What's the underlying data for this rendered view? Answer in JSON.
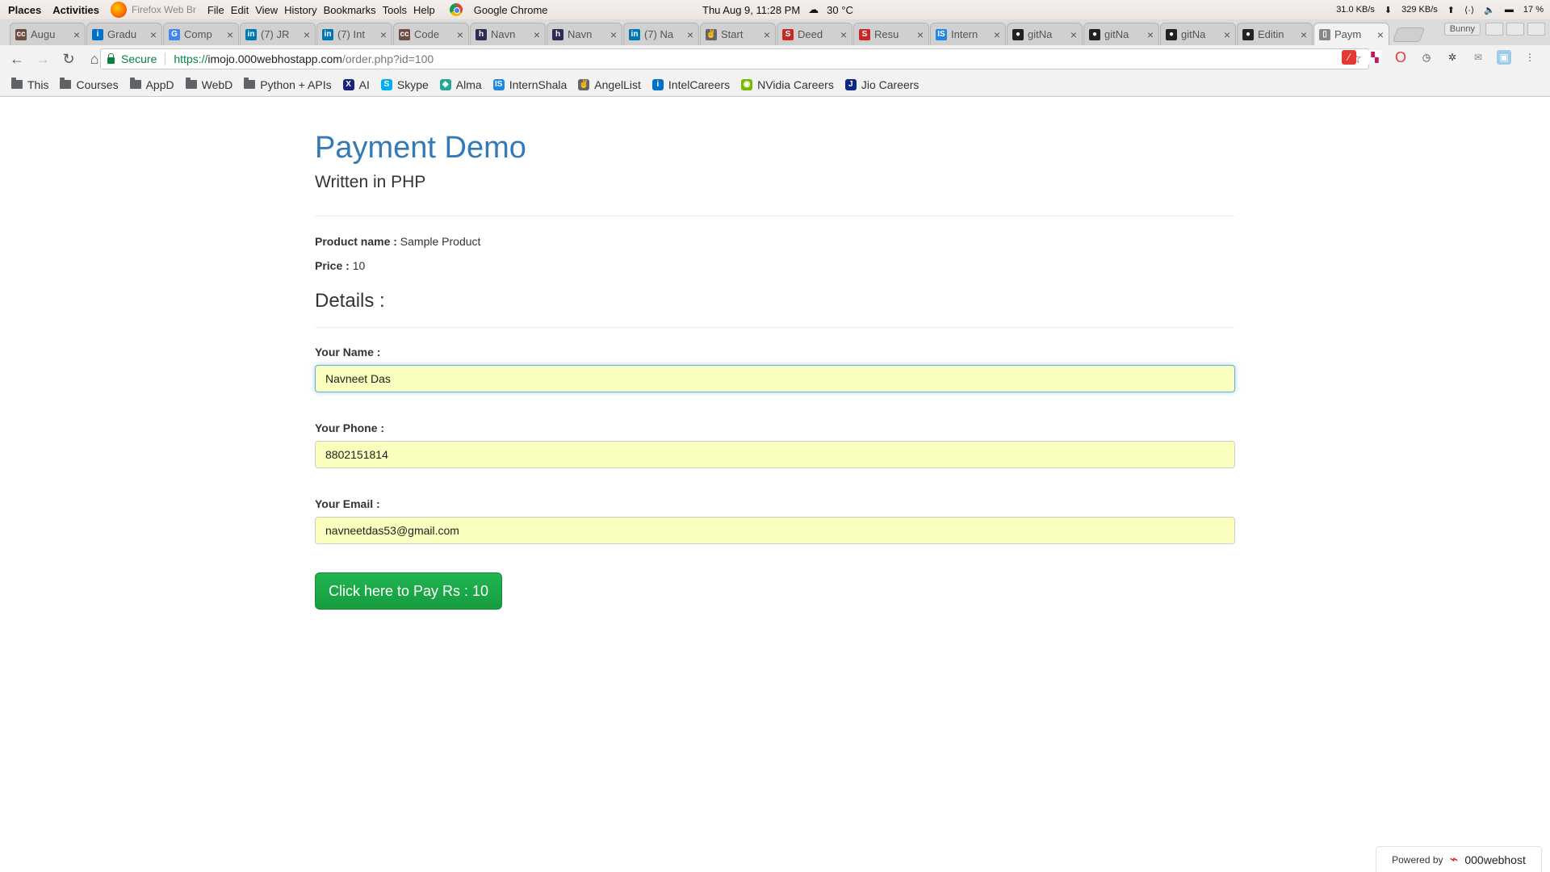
{
  "system_bar": {
    "places": "Places",
    "activities": "Activities",
    "app_name": "Firefox Web Br",
    "menu": [
      "File",
      "Edit",
      "View",
      "History",
      "Bookmarks",
      "Tools",
      "Help"
    ],
    "active_app": "Google Chrome",
    "clock": "Thu Aug  9, 11:28 PM",
    "weather": "30 °C",
    "download_rate": "31.0 KB/s",
    "upload_rate": "329 KB/s",
    "battery": "17 %"
  },
  "tabs": [
    {
      "title": "Augu",
      "icon": "cc-icon",
      "color": "#6d4c41"
    },
    {
      "title": "Gradu",
      "icon": "intel-icon",
      "color": "#0071c5"
    },
    {
      "title": "Comp",
      "icon": "google-icon",
      "color": "#4285f4"
    },
    {
      "title": "(7) JR",
      "icon": "linkedin-icon",
      "color": "#0077b5"
    },
    {
      "title": "(7) Int",
      "icon": "linkedin-icon",
      "color": "#0077b5"
    },
    {
      "title": "Code",
      "icon": "cc-icon",
      "color": "#6d4c41"
    },
    {
      "title": "Navn",
      "icon": "hackerrank-icon",
      "color": "#2c2c54"
    },
    {
      "title": "Navn",
      "icon": "hackerrank-icon",
      "color": "#2c2c54"
    },
    {
      "title": "(7) Na",
      "icon": "linkedin-icon",
      "color": "#0077b5"
    },
    {
      "title": "Start",
      "icon": "angellist-icon",
      "color": "#666666"
    },
    {
      "title": "Deed",
      "icon": "s-icon",
      "color": "#c62828"
    },
    {
      "title": "Resu",
      "icon": "s-icon",
      "color": "#c62828"
    },
    {
      "title": "Intern",
      "icon": "internshala-icon",
      "color": "#1e88e5"
    },
    {
      "title": "gitNa",
      "icon": "github-icon",
      "color": "#222222"
    },
    {
      "title": "gitNa",
      "icon": "github-icon",
      "color": "#222222"
    },
    {
      "title": "gitNa",
      "icon": "github-icon",
      "color": "#222222"
    },
    {
      "title": "Editin",
      "icon": "github-icon",
      "color": "#222222"
    },
    {
      "title": "Paym",
      "icon": "page-icon",
      "color": "#888888",
      "active": true
    }
  ],
  "profile": "Bunny",
  "address_bar": {
    "secure_label": "Secure",
    "scheme": "https://",
    "host": "imojo.000webhostapp.com",
    "path": "/order.php?id=100"
  },
  "bookmarks": [
    {
      "label": "This",
      "icon": "folder-icon"
    },
    {
      "label": "Courses",
      "icon": "folder-icon"
    },
    {
      "label": "AppD",
      "icon": "folder-icon"
    },
    {
      "label": "WebD",
      "icon": "folder-icon"
    },
    {
      "label": "Python + APIs",
      "icon": "folder-icon"
    },
    {
      "label": "AI",
      "icon": "ai-icon"
    },
    {
      "label": "Skype",
      "icon": "skype-icon"
    },
    {
      "label": "Alma",
      "icon": "alma-icon"
    },
    {
      "label": "InternShala",
      "icon": "internshala-icon"
    },
    {
      "label": "AngelList",
      "icon": "angellist-icon"
    },
    {
      "label": "IntelCareers",
      "icon": "intel-icon"
    },
    {
      "label": "NVidia Careers",
      "icon": "nvidia-icon"
    },
    {
      "label": "Jio Careers",
      "icon": "jio-icon"
    }
  ],
  "page": {
    "title": "Payment Demo",
    "subtitle": "Written in PHP",
    "product_name_label": "Product name :",
    "product_name": "Sample Product",
    "price_label": "Price :",
    "price": "10",
    "details_heading": "Details :",
    "name_label": "Your Name :",
    "name_value": "Navneet Das",
    "phone_label": "Your Phone :",
    "phone_value": "8802151814",
    "email_label": "Your Email :",
    "email_value": "navneetdas53@gmail.com",
    "pay_button": "Click here to Pay Rs : 10"
  },
  "footer": {
    "powered_by": "Powered by",
    "host_brand": "000webhost"
  },
  "colors": {
    "heading_blue": "#337ab7",
    "autofill_yellow": "#faffbd",
    "pay_green": "#1fa94b",
    "secure_green": "#0b8043"
  }
}
